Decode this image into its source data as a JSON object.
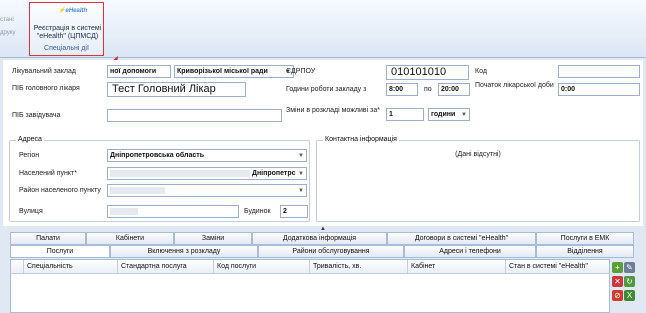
{
  "ribbon": {
    "left_items": [
      "стані",
      "друку"
    ],
    "icon_label": "eHealth",
    "button_label": "Реєстрація в системі \"eHealth\" (ЦПМСД)",
    "group_label": "Спеціальні дії"
  },
  "form": {
    "facility_label": "Лікувальний заклад",
    "facility_value_left": "ної допомоги",
    "facility_value_right": "Криворізької міської ради",
    "head_doctor_label": "ПІБ головного лікаря",
    "head_doctor_value": "Тест Головний Лікар",
    "manager_label": "ПІБ завідувача",
    "manager_value": "",
    "edrpou_label": "ЄДРПОУ",
    "edrpou_value": "010101010",
    "code_label": "Код",
    "code_value": "",
    "hours_label": "Години роботи закладу з",
    "hours_from": "8:00",
    "hours_to_label": "по",
    "hours_to": "20:00",
    "shift_start_label": "Початок лікарської доби",
    "shift_start_value": "0:00",
    "schedule_change_label": "Зміни в розкладі можливі за*",
    "schedule_change_value": "1",
    "schedule_change_unit": "години",
    "address_legend": "Адреса",
    "region_label": "Регіон",
    "region_value": "Дніпропетровська область",
    "locality_label": "Населений пункт*",
    "locality_value": "Дніпропетрс",
    "district_label": "Район населеного пункту",
    "street_label": "Вулиця",
    "house_label": "Будинок",
    "house_value": "2",
    "contact_legend": "Контактна інформація",
    "contact_empty": "(Дані відсутні)"
  },
  "tabs_row1": [
    "Палати",
    "Кабінети",
    "Заміни",
    "Додаткова інформація",
    "Договори в системі \"eHealth\"",
    "Послуги в ЕМК"
  ],
  "tabs_row2": [
    "Послуги",
    "Включення з розкладу",
    "Райони обслуговування",
    "Адреси і телефони",
    "Відділення"
  ],
  "grid": {
    "columns": [
      "Спеціальність",
      "Стандартна послуга",
      "Код послуги",
      "Тривалість, хв.",
      "Кабінет",
      "Стан в системі \"eHealth\""
    ]
  },
  "colors": {
    "highlight_border": "#e0313c",
    "arrow": "#e0202a",
    "ribbon_bg": "#dbe6f4"
  }
}
